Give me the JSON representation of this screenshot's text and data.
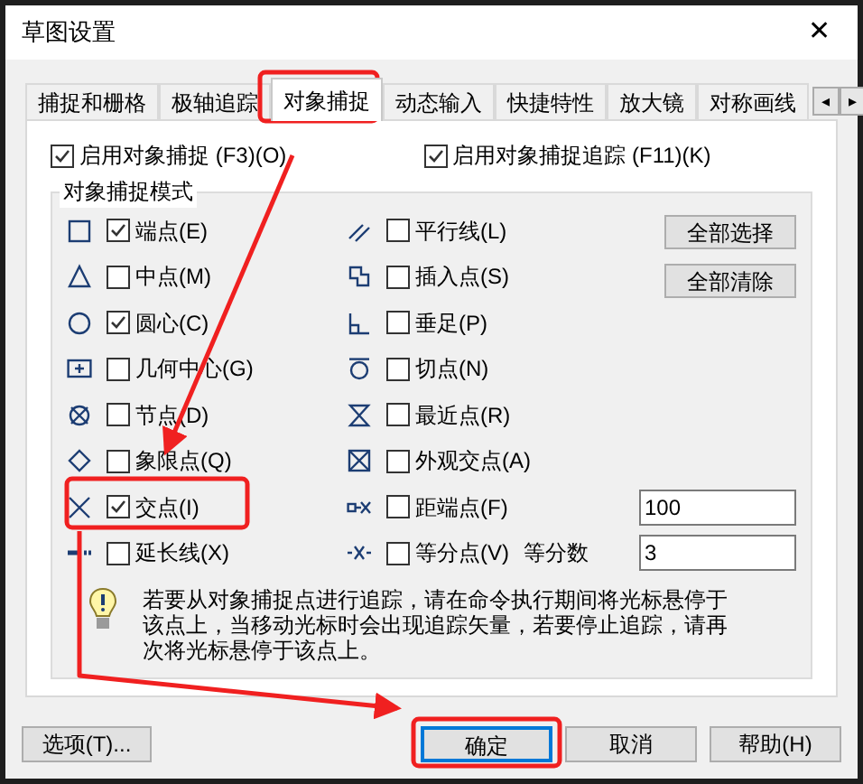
{
  "window": {
    "title": "草图设置",
    "close": "✕"
  },
  "tabs": [
    {
      "label": "捕捉和栅格",
      "selected": false
    },
    {
      "label": "极轴追踪",
      "selected": false
    },
    {
      "label": "对象捕捉",
      "selected": true
    },
    {
      "label": "动态输入",
      "selected": false
    },
    {
      "label": "快捷特性",
      "selected": false
    },
    {
      "label": "放大镜",
      "selected": false
    },
    {
      "label": "对称画线",
      "selected": false
    }
  ],
  "tab_scroll": [
    "◂",
    "▸"
  ],
  "enable_snap": {
    "label": "启用对象捕捉 (F3)(O)",
    "checked": true
  },
  "enable_tracking": {
    "label": "启用对象捕捉追踪 (F11)(K)",
    "checked": true
  },
  "group": {
    "title": "对象捕捉模式",
    "left_modes": [
      {
        "label": "端点(E)",
        "checked": true
      },
      {
        "label": "中点(M)",
        "checked": false
      },
      {
        "label": "圆心(C)",
        "checked": true
      },
      {
        "label": "几何中心(G)",
        "checked": false
      },
      {
        "label": "节点(D)",
        "checked": false
      },
      {
        "label": "象限点(Q)",
        "checked": false
      },
      {
        "label": "交点(I)",
        "checked": true
      },
      {
        "label": "延长线(X)",
        "checked": false
      }
    ],
    "right_modes": [
      {
        "label": "平行线(L)",
        "checked": false
      },
      {
        "label": "插入点(S)",
        "checked": false
      },
      {
        "label": "垂足(P)",
        "checked": false
      },
      {
        "label": "切点(N)",
        "checked": false
      },
      {
        "label": "最近点(R)",
        "checked": false
      },
      {
        "label": "外观交点(A)",
        "checked": false
      },
      {
        "label": "距端点(F)",
        "checked": false,
        "value": "100"
      },
      {
        "label": "等分点(V)",
        "checked": false,
        "extra_label": "等分数",
        "value": "3"
      }
    ],
    "buttons": [
      "全部选择",
      "全部清除"
    ],
    "hint": "若要从对象捕捉点进行追踪，请在命令执行期间将光标悬停于该点上，当移动光标时会出现追踪矢量，若要停止追踪，请再次将光标悬停于该点上。"
  },
  "footer": {
    "options": "选项(T)...",
    "ok": "确定",
    "cancel": "取消",
    "help": "帮助(H)"
  }
}
